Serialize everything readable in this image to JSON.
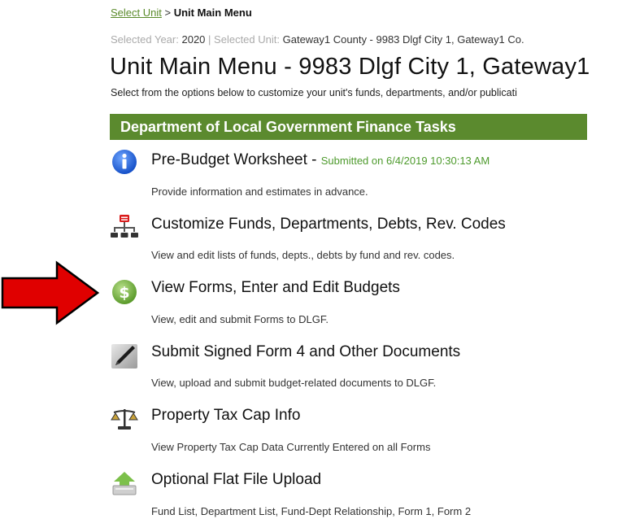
{
  "breadcrumb": {
    "link": "Select Unit",
    "separator": ">",
    "current": "Unit Main Menu"
  },
  "selection": {
    "year_label": "Selected Year:",
    "year": "2020",
    "divider": "|",
    "unit_label": "Selected Unit:",
    "unit": "Gateway1 County - 9983 Dlgf City 1, Gateway1 Co."
  },
  "page": {
    "title": "Unit Main Menu - 9983 Dlgf City 1, Gateway1",
    "intro": "Select from the options below to customize your unit's funds, departments, and/or publicati"
  },
  "section": {
    "header": "Department of Local Government Finance Tasks"
  },
  "tasks": [
    {
      "title": "Pre-Budget Worksheet",
      "dash": "-",
      "status": "Submitted on 6/4/2019 10:30:13 AM",
      "desc": "Provide information and estimates in advance.",
      "icon": "info-icon"
    },
    {
      "title": "Customize Funds, Departments, Debts, Rev. Codes",
      "desc": "View and edit lists of funds, depts., debts by fund and rev. codes.",
      "icon": "org-chart-icon"
    },
    {
      "title": "View Forms, Enter and Edit Budgets",
      "desc": "View, edit and submit Forms to DLGF.",
      "icon": "dollar-coin-icon"
    },
    {
      "title": "Submit Signed Form 4 and Other Documents",
      "desc": "View, upload and submit budget-related documents to DLGF.",
      "icon": "pen-sign-icon"
    },
    {
      "title": "Property Tax Cap Info",
      "desc": "View Property Tax Cap Data Currently Entered on all Forms",
      "icon": "scales-icon"
    },
    {
      "title": "Optional Flat File Upload",
      "desc": "Fund List, Department List, Fund-Dept Relationship, Form 1, Form 2",
      "icon": "upload-icon"
    }
  ],
  "colors": {
    "header_bg": "#5b8a2e",
    "link": "#5a8a2a",
    "status": "#4d9a2c",
    "arrow": "#e00000"
  }
}
